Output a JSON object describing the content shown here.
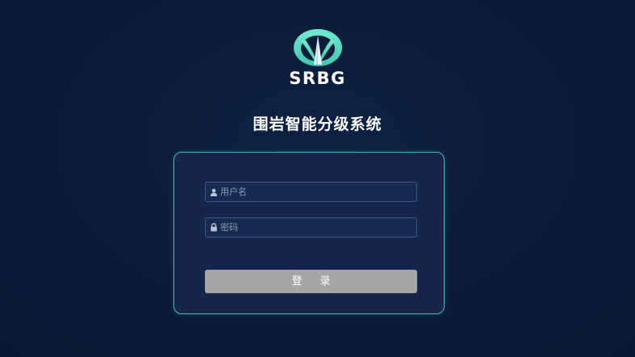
{
  "logo": {
    "text": "SRBG",
    "icon": "srbg-emblem-icon"
  },
  "title": "围岩智能分级系统",
  "login_form": {
    "username": {
      "placeholder": "用户名",
      "value": "",
      "icon": "user-icon"
    },
    "password": {
      "placeholder": "密码",
      "value": "",
      "icon": "lock-icon"
    },
    "submit_label": "登录"
  },
  "colors": {
    "background": "#0b1c38",
    "card_background": "#15254b",
    "card_border": "#47b7b5",
    "logo_teal": "#4fdcc0",
    "button_background": "#a6a6a6"
  }
}
